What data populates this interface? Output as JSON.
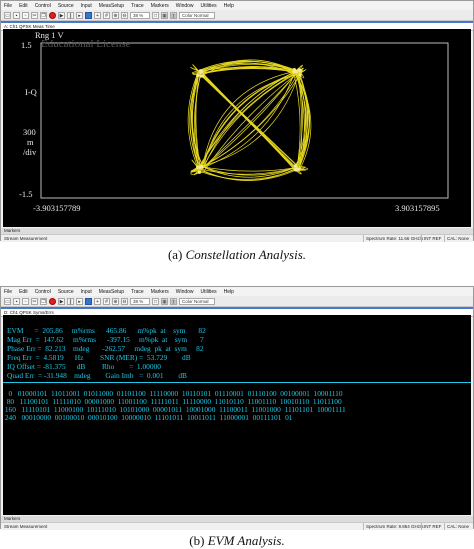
{
  "menu": [
    "File",
    "Edit",
    "Control",
    "Source",
    "Input",
    "MeasSetup",
    "Trace",
    "Markers",
    "Window",
    "Utilities",
    "Help"
  ],
  "toolbar": {
    "zoom": "38 %",
    "color_mode": "Color Normal"
  },
  "screen_a": {
    "tab_title": "A: Ch1 QPSK Meas Time",
    "ring_label": "Rng 1  V",
    "watermark": "Educational License",
    "y_top": "1.5",
    "y_axis_label": "I-Q",
    "scale_value": "300",
    "scale_unit": "m",
    "scale_per": "/div",
    "y_bottom": "-1.5",
    "x_left": "-3.903157789",
    "x_right": "3.903157895",
    "markers_tab": "Markers",
    "status_left": "Stream Measurement",
    "status_rate": "Spectrum Rate: 11.66 GHz/s",
    "status_ref": "INT REF",
    "status_cal": "CAL: None"
  },
  "caption_a": {
    "label": "(a)",
    "text": "Constellation Analysis."
  },
  "screen_b": {
    "tab_title": "D: Ch1 QPSK Syms/Errs",
    "rows": [
      "EVM      =  205.86     m%rms      465.86      m%pk  at    sym       82",
      "Mag Err  =  147.62     m%rms      -397.15     m%pk  at    sym       7",
      "Phase Err =  82.213    mdeg       -262.57     mdeg  pk  at  sym     82",
      "Freq Err  =  4.5819      Hz         SNR (MER) =  53.729        dB",
      "IQ Offset = -81.375      dB         Rho        =  1.00000",
      "Quad Err  = -31.948    mdeg        Gain Imb   =  0.001        dB"
    ],
    "bit_rows": [
      "   0   01000101  11011001  01011000  01101100  11110000  10110101  01110001  01110100  00100001  10001110",
      "  80   11100101  11111010  00001000  11001100  11111011  11110000  11010110  11001110  10010110  11011100",
      " 160   11110101  11000100  10111010  10101000  00001011  10001000  11100011  11001000  11101101  10001111",
      " 240   00010000  00100010  00010100  10000010  11101011  10011011  11000001  00111101  01"
    ],
    "markers_tab": "Markers",
    "status_left": "Stream Measurement",
    "status_rate": "Spectrum Rate: 9.864 GHz/s",
    "status_ref": "INT REF",
    "status_cal": "CAL: None"
  },
  "caption_b": {
    "label": "(b)",
    "text": "EVM Analysis."
  }
}
